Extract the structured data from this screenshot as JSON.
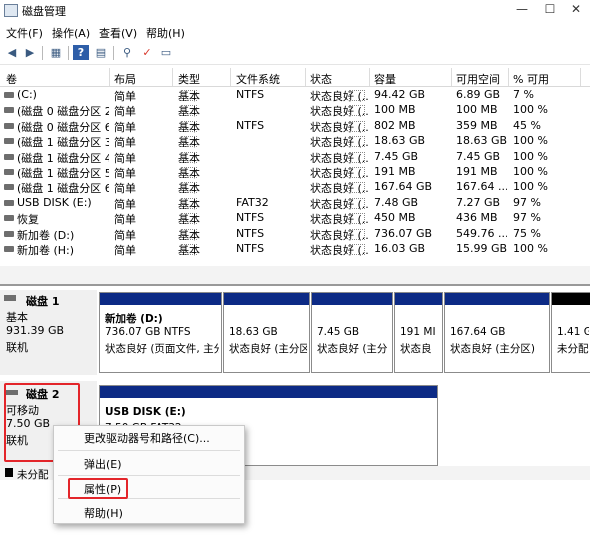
{
  "window": {
    "title": "磁盘管理",
    "controls": {
      "minimize": "—",
      "maximize": "☐",
      "close": "✕"
    }
  },
  "menu": [
    "文件(F)",
    "操作(A)",
    "查看(V)",
    "帮助(H)"
  ],
  "toolbar": [
    "back-icon",
    "forward-icon",
    "console-icon",
    "help-icon",
    "disk-icon",
    "properties-icon",
    "check-icon",
    "window-icon"
  ],
  "volume_table": {
    "headers": [
      "卷",
      "布局",
      "类型",
      "文件系统",
      "状态",
      "容量",
      "可用空间",
      "% 可用"
    ],
    "rows": [
      [
        "(C:)",
        "简单",
        "基本",
        "NTFS",
        "状态良好 (...",
        "94.42 GB",
        "6.89 GB",
        "7 %"
      ],
      [
        "(磁盘 0 磁盘分区 2)",
        "简单",
        "基本",
        "",
        "状态良好 (...",
        "100 MB",
        "100 MB",
        "100 %"
      ],
      [
        "(磁盘 0 磁盘分区 6)",
        "简单",
        "基本",
        "NTFS",
        "状态良好 (...",
        "802 MB",
        "359 MB",
        "45 %"
      ],
      [
        "(磁盘 1 磁盘分区 3)",
        "简单",
        "基本",
        "",
        "状态良好 (...",
        "18.63 GB",
        "18.63 GB",
        "100 %"
      ],
      [
        "(磁盘 1 磁盘分区 4)",
        "简单",
        "基本",
        "",
        "状态良好 (...",
        "7.45 GB",
        "7.45 GB",
        "100 %"
      ],
      [
        "(磁盘 1 磁盘分区 5)",
        "简单",
        "基本",
        "",
        "状态良好 (...",
        "191 MB",
        "191 MB",
        "100 %"
      ],
      [
        "(磁盘 1 磁盘分区 6)",
        "简单",
        "基本",
        "",
        "状态良好 (...",
        "167.64 GB",
        "167.64 ...",
        "100 %"
      ],
      [
        "USB DISK (E:)",
        "简单",
        "基本",
        "FAT32",
        "状态良好 (...",
        "7.48 GB",
        "7.27 GB",
        "97 %"
      ],
      [
        "恢复",
        "简单",
        "基本",
        "NTFS",
        "状态良好 (...",
        "450 MB",
        "436 MB",
        "97 %"
      ],
      [
        "新加卷 (D:)",
        "简单",
        "基本",
        "NTFS",
        "状态良好 (...",
        "736.07 GB",
        "549.76 ...",
        "75 %"
      ],
      [
        "新加卷 (H:)",
        "简单",
        "基本",
        "NTFS",
        "状态良好 (...",
        "16.03 GB",
        "15.99 GB",
        "100 %"
      ]
    ]
  },
  "disks": [
    {
      "name": "磁盘 1",
      "kind": "基本",
      "size": "931.39 GB",
      "status": "联机",
      "partitions": [
        {
          "name": "新加卷 (D:)",
          "line1": "736.07 GB NTFS",
          "line2": "状态良好 (页面文件, 主分"
        },
        {
          "name": "",
          "line1": "18.63 GB",
          "line2": "状态良好 (主分区"
        },
        {
          "name": "",
          "line1": "7.45 GB",
          "line2": "状态良好 (主分"
        },
        {
          "name": "",
          "line1": "191 MI",
          "line2": "状态良"
        },
        {
          "name": "",
          "line1": "167.64 GB",
          "line2": "状态良好 (主分区)"
        },
        {
          "name": "",
          "line1": "1.41 G",
          "line2": "未分配"
        }
      ]
    },
    {
      "name": "磁盘 2",
      "kind": "可移动",
      "size": "7.50 GB",
      "status": "联机",
      "partitions": [
        {
          "name": "USB DISK  (E:)",
          "line1": "7.50 GB FAT32",
          "line2": ""
        }
      ]
    }
  ],
  "legend": {
    "unallocated": "未分配"
  },
  "context_menu": [
    "更改驱动器号和路径(C)...",
    "弹出(E)",
    "属性(P)",
    "帮助(H)"
  ]
}
